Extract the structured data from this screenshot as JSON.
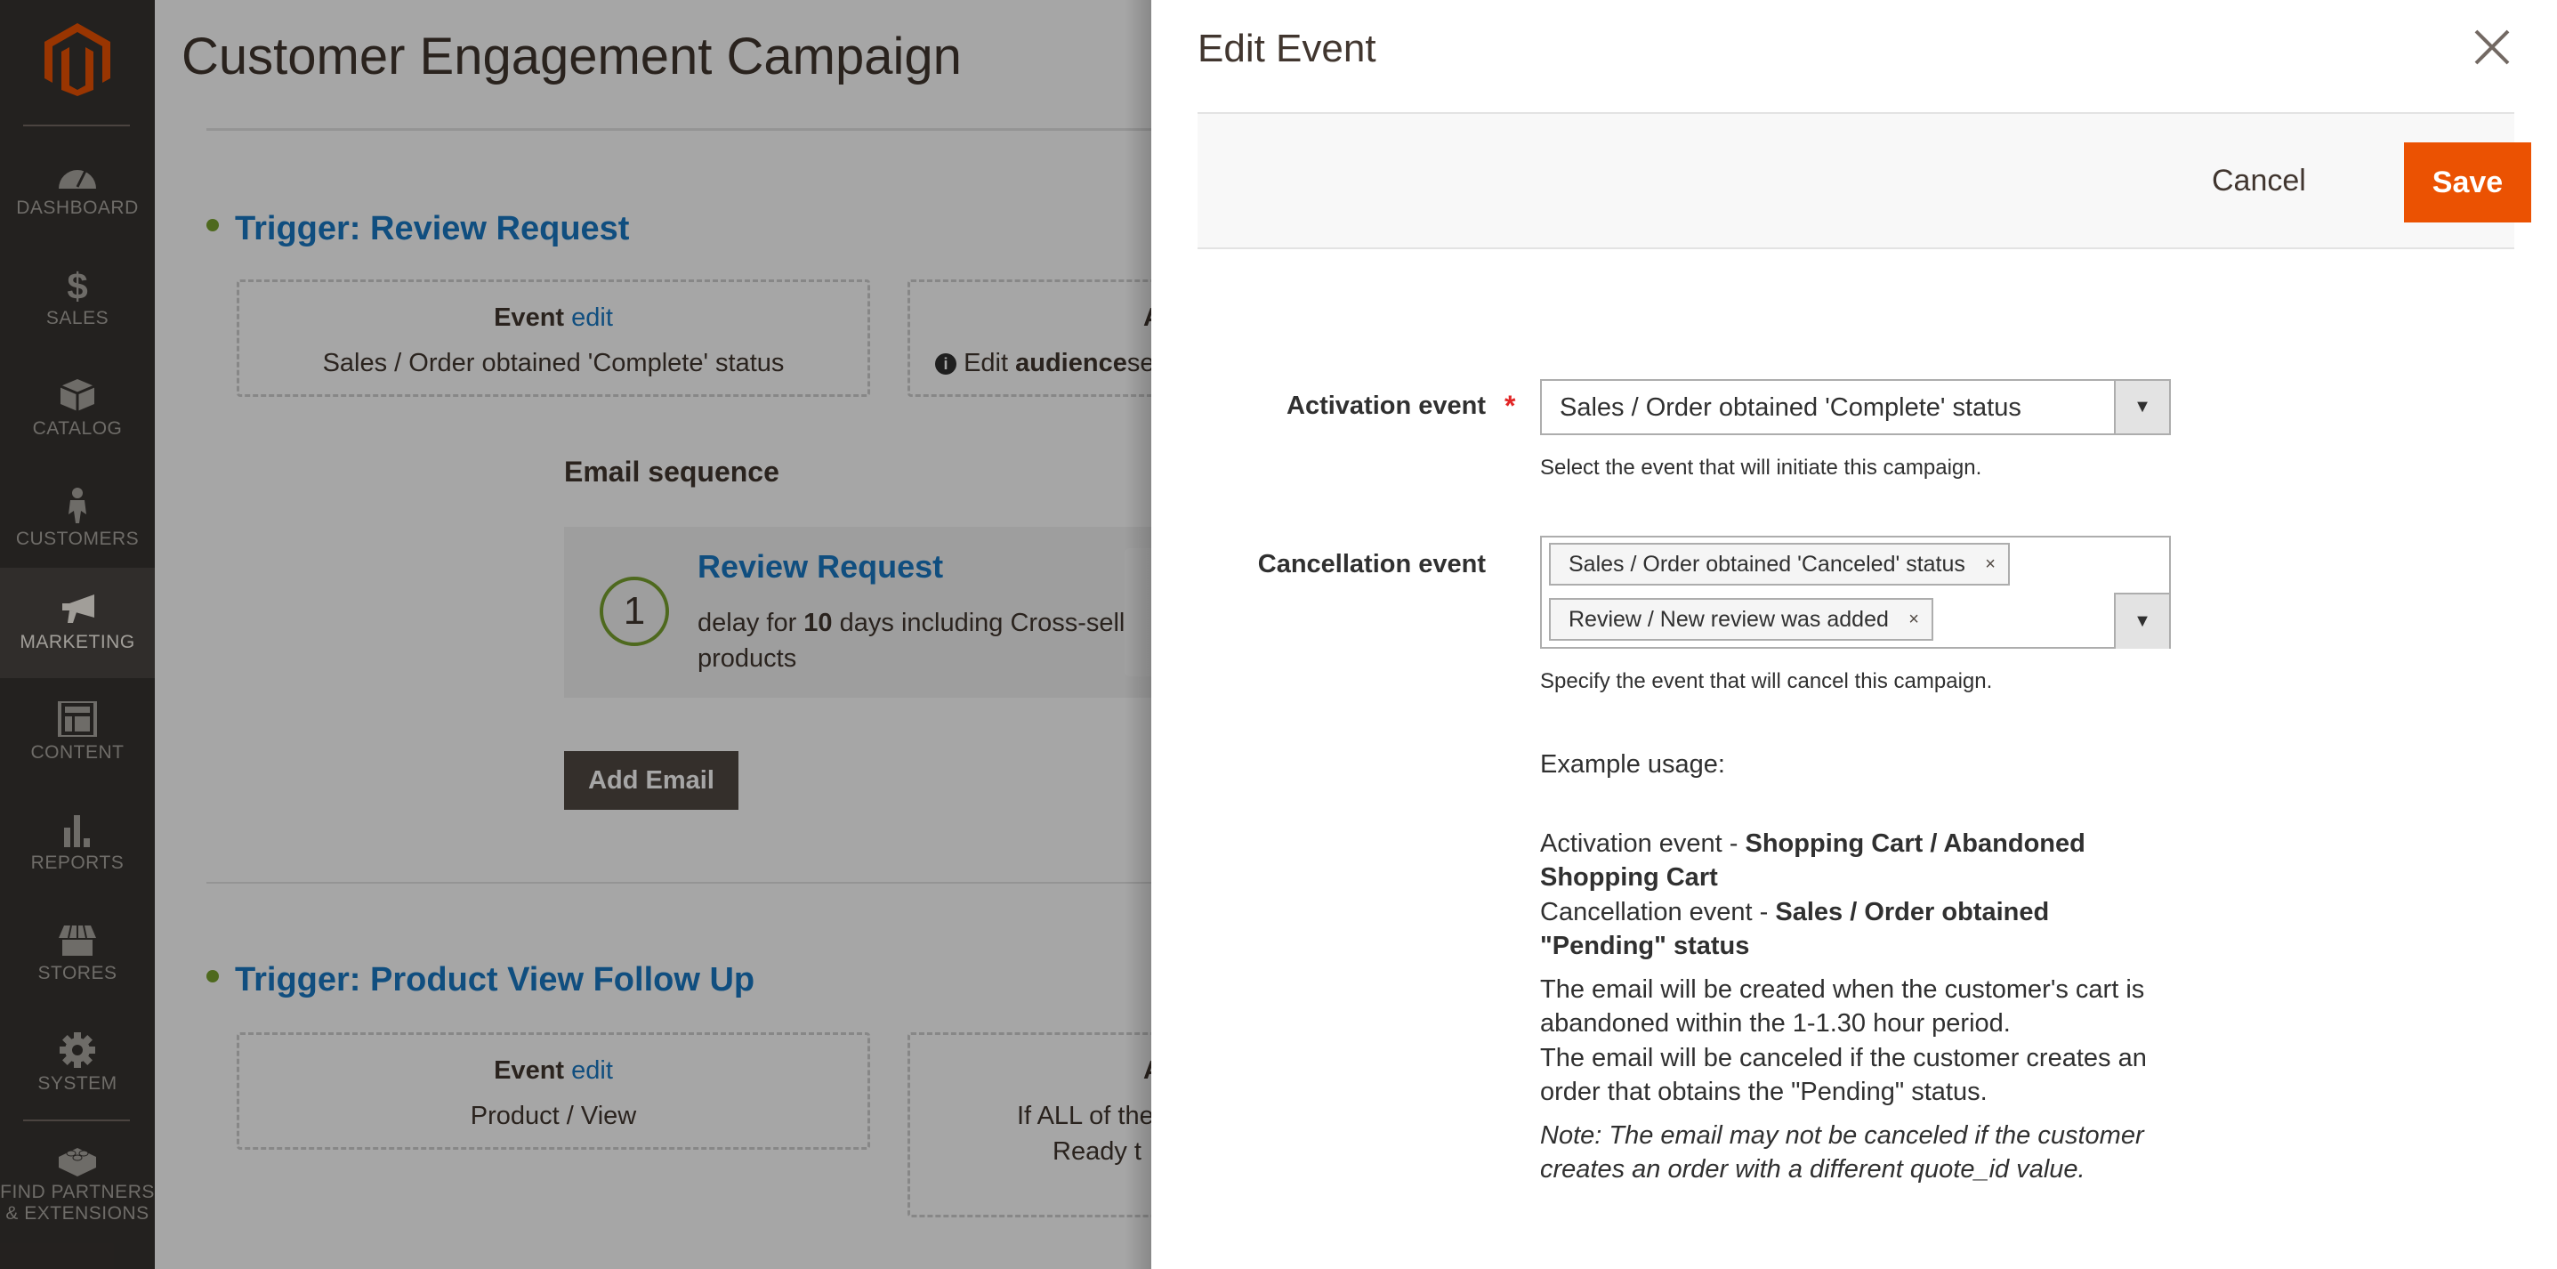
{
  "sidebar": {
    "logo": "magento-logo",
    "items": [
      {
        "label": "Dashboard",
        "icon": "dashboard-icon",
        "active": false
      },
      {
        "label": "Sales",
        "icon": "dollar-icon",
        "active": false
      },
      {
        "label": "Catalog",
        "icon": "box-icon",
        "active": false
      },
      {
        "label": "Customers",
        "icon": "person-icon",
        "active": false
      },
      {
        "label": "Marketing",
        "icon": "megaphone-icon",
        "active": true
      },
      {
        "label": "Content",
        "icon": "layout-icon",
        "active": false
      },
      {
        "label": "Reports",
        "icon": "bar-chart-icon",
        "active": false
      },
      {
        "label": "Stores",
        "icon": "store-icon",
        "active": false
      },
      {
        "label": "System",
        "icon": "gear-icon",
        "active": false
      }
    ],
    "extra": {
      "label_line1": "Find Partners",
      "label_line2": "& Extensions",
      "icon": "lego-block-icon"
    }
  },
  "main": {
    "page_title": "Customer Engagement Campaign",
    "triggers": [
      {
        "title": "Trigger: Review Request",
        "event_box": {
          "heading": "Event",
          "edit_link": "edit",
          "value": "Sales / Order obtained 'Complete' status"
        },
        "audience_box": {
          "heading": "A",
          "info_text_prefix": "Edit",
          "info_text_bold": "audience",
          "info_text_suffix": "se"
        }
      },
      {
        "title": "Trigger: Product View Follow Up",
        "event_box": {
          "heading": "Event",
          "edit_link": "edit",
          "value": "Product / View"
        },
        "audience_box": {
          "heading": "A",
          "line1": "If ALL of the",
          "line2": "Ready t"
        }
      }
    ],
    "email_sequence": {
      "title": "Email sequence",
      "emails": [
        {
          "number": "1",
          "name": "Review Request",
          "desc_prefix": "delay for",
          "desc_bold": "10",
          "desc_suffix": "days including Cross-sell products"
        }
      ],
      "add_button": "Add Email"
    }
  },
  "panel": {
    "title": "Edit Event",
    "close_icon": "close-icon",
    "cancel_label": "Cancel",
    "save_label": "Save",
    "activation": {
      "label": "Activation event",
      "required_mark": "*",
      "value": "Sales / Order obtained 'Complete' status",
      "note": "Select the event that will initiate this campaign."
    },
    "cancellation": {
      "label": "Cancellation event",
      "selected": [
        "Sales / Order obtained 'Canceled' status",
        "Review / New review was added"
      ],
      "remove_glyph": "×",
      "note": "Specify the event that will cancel this campaign."
    },
    "example": {
      "heading": "Example usage:",
      "activation_prefix": "Activation event - ",
      "activation_bold": "Shopping Cart / Abandoned Shopping Cart",
      "cancellation_prefix": "Cancellation event - ",
      "cancellation_bold": "Sales / Order obtained \"Pending\" status",
      "desc_line1": "The email will be created when the customer's cart is abandoned within the 1-1.30 hour period.",
      "desc_line2": "The email will be canceled if the customer creates an order that obtains the \"Pending\" status.",
      "note": "Note: The email may not be canceled if the customer creates an order with a different quote_id value."
    }
  },
  "colors": {
    "accent_orange": "#eb5202",
    "link_blue": "#1979c3",
    "status_green": "#79a22e",
    "sidebar_bg": "#373330",
    "required_red": "#e22626"
  }
}
